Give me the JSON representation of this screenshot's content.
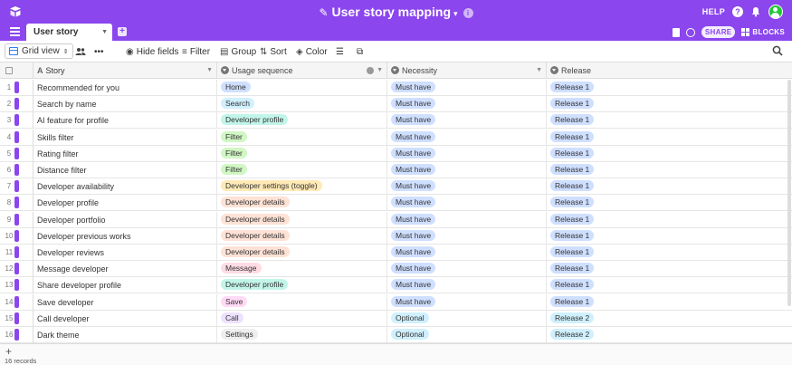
{
  "app": {
    "title": "User story mapping",
    "help_label": "HELP",
    "share_label": "SHARE",
    "blocks_label": "BLOCKS"
  },
  "tabs": [
    {
      "label": "User story mapping"
    }
  ],
  "toolbar": {
    "view_label": "Grid view",
    "hide_fields": "Hide fields",
    "filter": "Filter",
    "group": "Group",
    "sort": "Sort",
    "color": "Color"
  },
  "columns": {
    "story": "Story",
    "usage": "Usage sequence",
    "necessity": "Necessity",
    "release": "Release"
  },
  "colors": {
    "accent": "#8b46ee",
    "Home": "#cfdfff",
    "Search": "#d0f0fd",
    "Developer profile": "#c2f5e9",
    "Filter": "#d1f7c4",
    "Developer settings (toggle)": "#ffeab6",
    "Developer details": "#fee2d5",
    "Message": "#ffdce5",
    "Save": "#ffdaf6",
    "Call": "#ede2fe",
    "Settings": "#eeeeee",
    "Must have": "#cfdfff",
    "Optional": "#d0f0fd",
    "Release 1": "#cfdfff",
    "Release 2": "#d0f0fd"
  },
  "rows": [
    {
      "n": "1",
      "story": "Recommended for you",
      "usage": "Home",
      "necessity": "Must have",
      "release": "Release 1"
    },
    {
      "n": "2",
      "story": "Search by name",
      "usage": "Search",
      "necessity": "Must have",
      "release": "Release 1"
    },
    {
      "n": "3",
      "story": "AI feature for profile",
      "usage": "Developer profile",
      "necessity": "Must have",
      "release": "Release 1"
    },
    {
      "n": "4",
      "story": "Skills filter",
      "usage": "Filter",
      "necessity": "Must have",
      "release": "Release 1"
    },
    {
      "n": "5",
      "story": "Rating filter",
      "usage": "Filter",
      "necessity": "Must have",
      "release": "Release 1"
    },
    {
      "n": "6",
      "story": "Distance filter",
      "usage": "Filter",
      "necessity": "Must have",
      "release": "Release 1"
    },
    {
      "n": "7",
      "story": "Developer availability",
      "usage": "Developer settings (toggle)",
      "necessity": "Must have",
      "release": "Release 1"
    },
    {
      "n": "8",
      "story": "Developer profile",
      "usage": "Developer details",
      "necessity": "Must have",
      "release": "Release 1"
    },
    {
      "n": "9",
      "story": "Developer portfolio",
      "usage": "Developer details",
      "necessity": "Must have",
      "release": "Release 1"
    },
    {
      "n": "10",
      "story": "Developer previous works",
      "usage": "Developer details",
      "necessity": "Must have",
      "release": "Release 1"
    },
    {
      "n": "11",
      "story": "Developer reviews",
      "usage": "Developer details",
      "necessity": "Must have",
      "release": "Release 1"
    },
    {
      "n": "12",
      "story": "Message developer",
      "usage": "Message",
      "necessity": "Must have",
      "release": "Release 1"
    },
    {
      "n": "13",
      "story": "Share developer profile",
      "usage": "Developer profile",
      "necessity": "Must have",
      "release": "Release 1"
    },
    {
      "n": "14",
      "story": "Save developer",
      "usage": "Save",
      "necessity": "Must have",
      "release": "Release 1"
    },
    {
      "n": "15",
      "story": "Call developer",
      "usage": "Call",
      "necessity": "Optional",
      "release": "Release 2"
    },
    {
      "n": "16",
      "story": "Dark theme",
      "usage": "Settings",
      "necessity": "Optional",
      "release": "Release 2"
    }
  ],
  "footer": {
    "add_label": "+",
    "record_count": "16 records"
  }
}
